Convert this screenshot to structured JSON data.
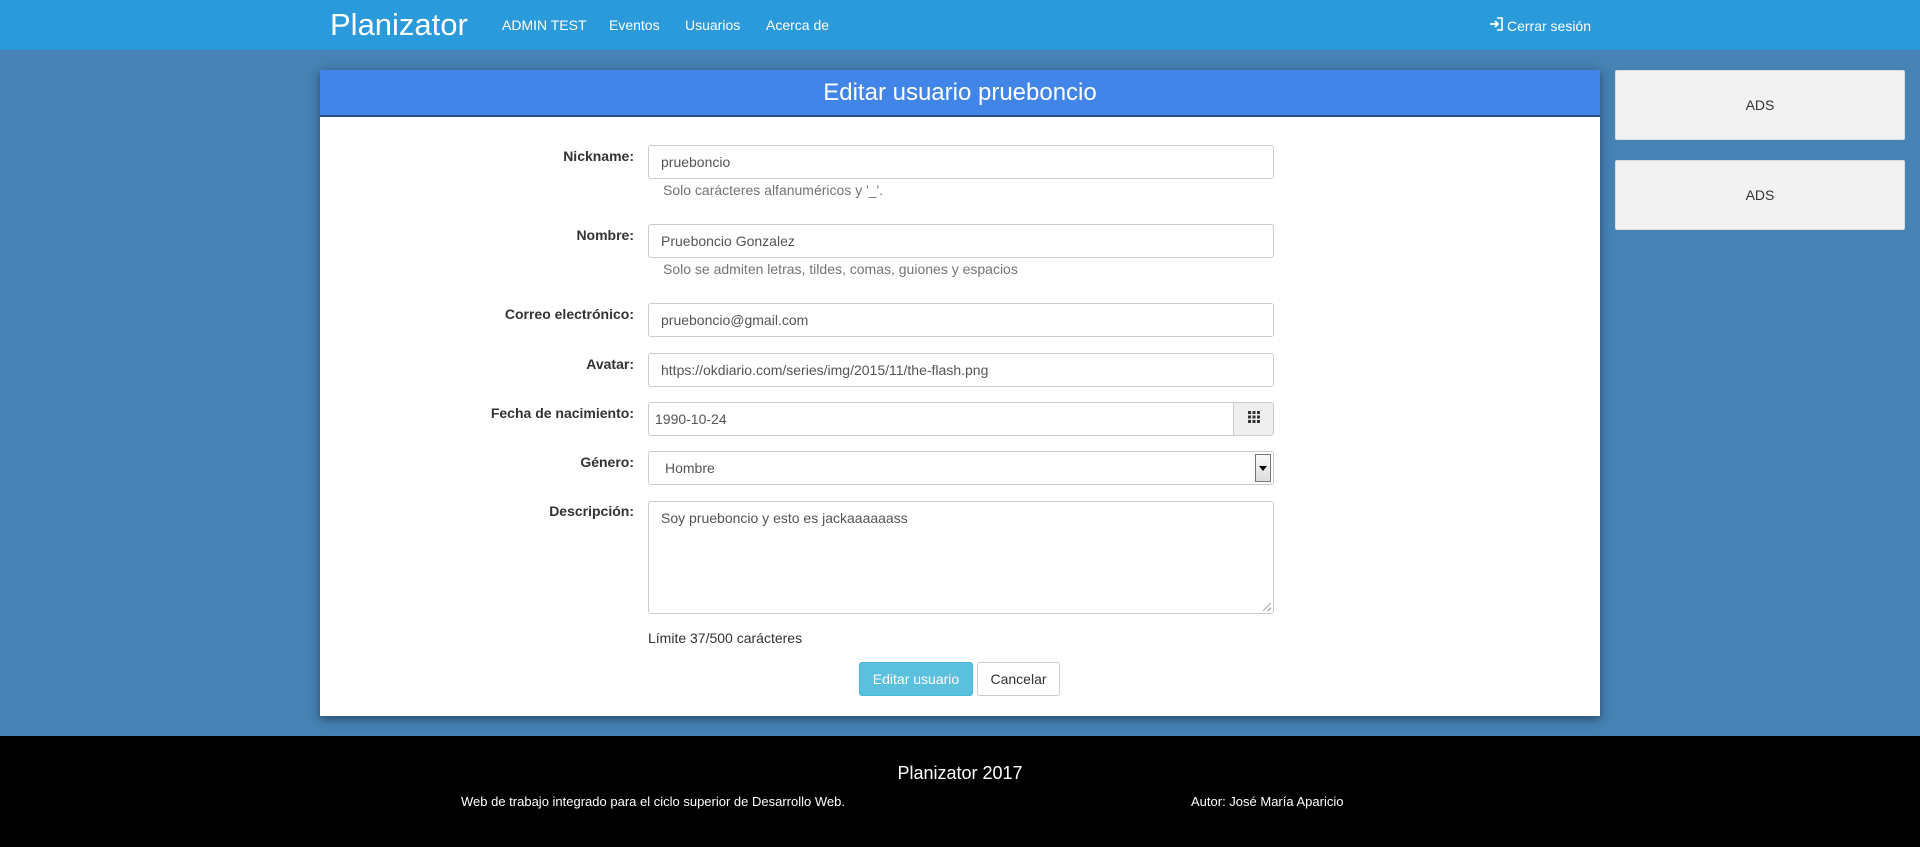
{
  "navbar": {
    "brand": "Planizator",
    "links": [
      "ADMIN TEST",
      "Eventos",
      "Usuarios",
      "Acerca de"
    ],
    "logout": "Cerrar sesión"
  },
  "form": {
    "title": "Editar usuario prueboncio",
    "fields": {
      "nickname": {
        "label": "Nickname:",
        "value": "prueboncio",
        "help": "Solo carácteres alfanuméricos y '_'."
      },
      "nombre": {
        "label": "Nombre:",
        "value": "Prueboncio Gonzalez",
        "help": "Solo se admiten letras, tildes, comas, guiones y espacios"
      },
      "correo": {
        "label": "Correo electrónico:",
        "value": "prueboncio@gmail.com"
      },
      "avatar": {
        "label": "Avatar:",
        "value": "https://okdiario.com/series/img/2015/11/the-flash.png"
      },
      "fecha": {
        "label": "Fecha de nacimiento:",
        "value": "1990-10-24"
      },
      "genero": {
        "label": "Género:",
        "value": "Hombre"
      },
      "descripcion": {
        "label": "Descripción:",
        "value": "Soy prueboncio y esto es jackaaaaaass"
      }
    },
    "limit": "Límite 37/500 carácteres",
    "submit": "Editar usuario",
    "cancel": "Cancelar"
  },
  "ads": [
    "ADS",
    "ADS"
  ],
  "footer": {
    "title": "Planizator 2017",
    "left": "Web de trabajo integrado para el ciclo superior de Desarrollo Web.",
    "right": "Autor: José María Aparicio"
  },
  "colors": {
    "navbar": "#2b9ada",
    "background": "#4682b4",
    "panel_header": "#4285e8",
    "primary_button": "#5bc0de",
    "footer": "#000000"
  },
  "icons": {
    "logout": "sign-out-icon",
    "calendar": "calendar-grid-icon",
    "select": "chevron-down-icon"
  }
}
